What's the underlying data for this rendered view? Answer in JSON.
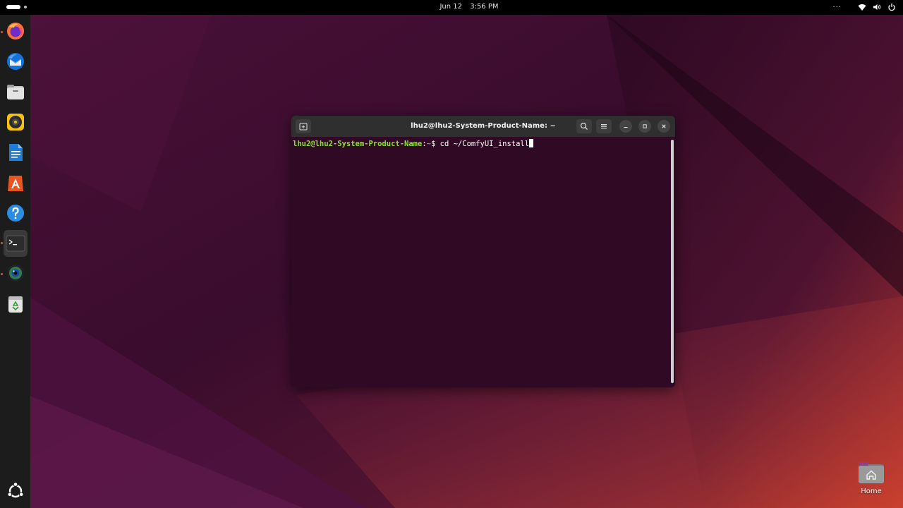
{
  "topbar": {
    "date": "Jun 12",
    "time": "3:56 PM",
    "overflow": "···"
  },
  "dock": {
    "items": [
      {
        "name": "firefox",
        "icon": "firefox-icon",
        "running": true
      },
      {
        "name": "thunderbird",
        "icon": "thunderbird-icon",
        "running": false
      },
      {
        "name": "files",
        "icon": "files-icon",
        "running": false
      },
      {
        "name": "rhythmbox",
        "icon": "rhythmbox-icon",
        "running": false
      },
      {
        "name": "writer",
        "icon": "libreoffice-writer-icon",
        "running": false
      },
      {
        "name": "app-center",
        "icon": "app-center-icon",
        "running": false
      },
      {
        "name": "help",
        "icon": "help-icon",
        "running": false
      },
      {
        "name": "terminal",
        "icon": "terminal-icon",
        "running": true,
        "active": true
      },
      {
        "name": "camera-app",
        "icon": "camera-lens-icon",
        "running": true
      },
      {
        "name": "trash",
        "icon": "trash-icon",
        "running": false
      }
    ],
    "show_apps_icon": "ubuntu-logo-icon"
  },
  "terminal": {
    "title": "lhu2@lhu2-System-Product-Name: ~",
    "prompt_user": "lhu2@lhu2-System-Product-Name",
    "prompt_sep": ":",
    "prompt_path": "~",
    "prompt_symbol": "$ ",
    "command": "cd ~/ComfyUI_install"
  },
  "desktop": {
    "home_label": "Home"
  },
  "colors": {
    "terminal_bg": "#300a24",
    "prompt_user": "#8ae234",
    "prompt_path": "#729fcf",
    "accent": "#e95420"
  }
}
